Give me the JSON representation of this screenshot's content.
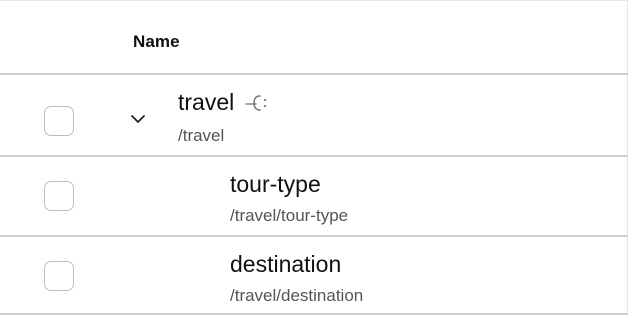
{
  "table": {
    "header": {
      "name_label": "Name"
    },
    "rows": [
      {
        "name": "travel",
        "path": "/travel",
        "expanded": true,
        "checked": false,
        "icons": [
          "chevron-down-icon",
          "edit-icon"
        ]
      },
      {
        "name": "tour-type",
        "path": "/travel/tour-type",
        "checked": false
      },
      {
        "name": "destination",
        "path": "/travel/destination",
        "checked": false
      }
    ]
  },
  "colors": {
    "divider": "#cfcfcf",
    "checkbox_border": "#bdbdbd",
    "path_text": "#555555",
    "name_text": "#111111"
  }
}
